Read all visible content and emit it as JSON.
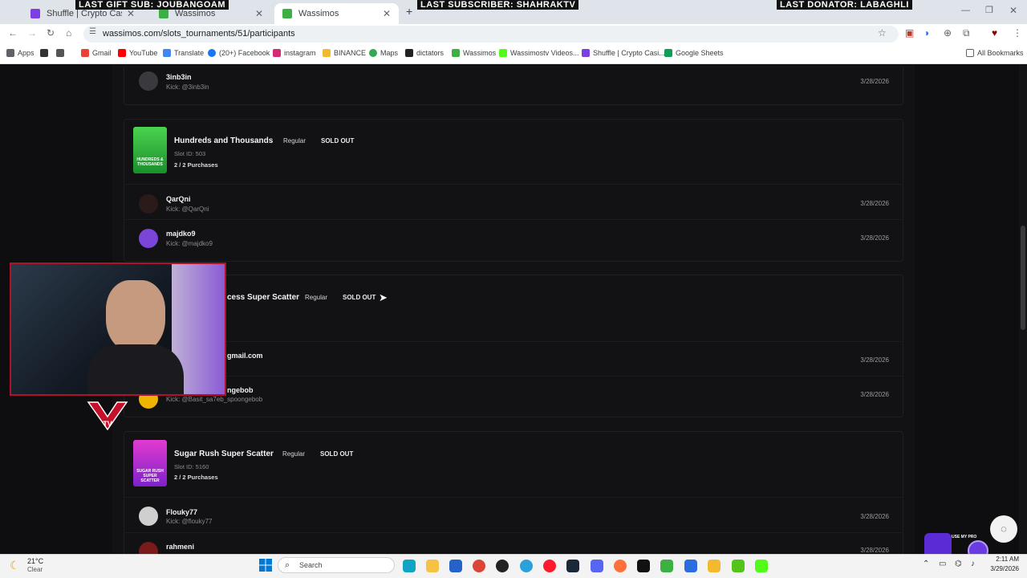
{
  "browser": {
    "tabs": [
      {
        "label": "Shuffle | Crypto Casino & Bitc",
        "active": false
      },
      {
        "label": "Wassimos",
        "active": false
      },
      {
        "label": "Wassimos",
        "active": true
      }
    ],
    "overlay_banners": [
      "LAST GIFT SUB: JOUBANGOAM",
      "LAST SUBSCRIBER: SHAHRAKTV",
      "LAST DONATOR: LABAGHLI"
    ],
    "url": "wassimos.com/slots_tournaments/51/participants",
    "bookmarks": [
      "Apps",
      "Gmail",
      "YouTube",
      "Translate",
      "(20+) Facebook",
      "instagram",
      "BINANCE",
      "Maps",
      "dictators",
      "Wassimos",
      "Wassimostv Videos...",
      "Shuffle | Crypto Casi...",
      "Google Sheets"
    ],
    "all_bookmarks": "All Bookmarks"
  },
  "page": {
    "top_participant": {
      "name": "3inb3in",
      "kick": "Kick: @3inb3in",
      "date": "3/28/2026"
    },
    "slots": [
      {
        "title": "Hundreds and Thousands",
        "type": "Regular",
        "status": "SOLD OUT",
        "slot_id": "Slot ID: 503",
        "purchases": "2 / 2 Purchases",
        "image_text": "HUNDREDS & THOUSANDS",
        "participants": [
          {
            "name": "QarQni",
            "kick": "Kick: @QarQni",
            "date": "3/28/2026"
          },
          {
            "name": "majdko9",
            "kick": "Kick: @majdko9",
            "date": "3/28/2026"
          }
        ]
      },
      {
        "title": "cess Super Scatter",
        "type": "Regular",
        "status": "SOLD OUT",
        "participants": [
          {
            "name": "gmail.com",
            "kick": "",
            "date": "3/28/2026"
          },
          {
            "name": "ngebob",
            "kick": "Kick: @Basit_sa7eb_spoongebob",
            "date": "3/28/2026"
          }
        ]
      },
      {
        "title": "Sugar Rush Super Scatter",
        "type": "Regular",
        "status": "SOLD OUT",
        "slot_id": "Slot ID: 5160",
        "purchases": "2 / 2 Purchases",
        "image_text": "SUGAR RUSH SUPER SCATTER",
        "participants": [
          {
            "name": "Flouky77",
            "kick": "Kick: @flouky77",
            "date": "3/28/2026"
          },
          {
            "name": "rahmeni",
            "kick": "",
            "date": "3/28/2026"
          }
        ]
      }
    ],
    "promo_text": "USE MY PRO"
  },
  "taskbar": {
    "weather_temp": "21°C",
    "weather_desc": "Clear",
    "search": "Search",
    "time": "2:11 AM",
    "date": "3/29/2026"
  },
  "colors": {
    "accent": "#8a2be2",
    "webcam_border": "#b1122a",
    "page_bg": "#0e0e10"
  }
}
